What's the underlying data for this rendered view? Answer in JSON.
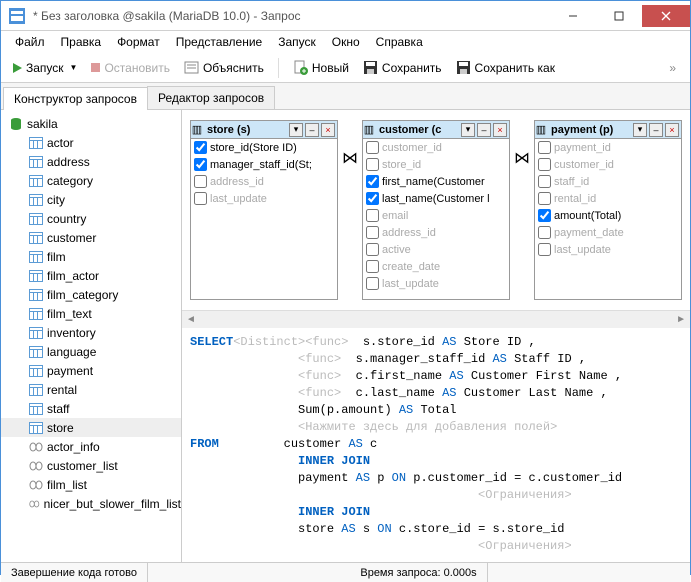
{
  "window": {
    "title": "* Без заголовка @sakila (MariaDB 10.0) - Запрос"
  },
  "menu": [
    "Файл",
    "Правка",
    "Формат",
    "Представление",
    "Запуск",
    "Окно",
    "Справка"
  ],
  "toolbar": {
    "run": "Запуск",
    "stop": "Остановить",
    "explain": "Объяснить",
    "new": "Новый",
    "save": "Сохранить",
    "saveas": "Сохранить как"
  },
  "tabs": {
    "builder": "Конструктор запросов",
    "editor": "Редактор запросов"
  },
  "db": {
    "name": "sakila",
    "tables": [
      "actor",
      "address",
      "category",
      "city",
      "country",
      "customer",
      "film",
      "film_actor",
      "film_category",
      "film_text",
      "inventory",
      "language",
      "payment",
      "rental",
      "staff",
      "store"
    ],
    "views": [
      "actor_info",
      "customer_list",
      "film_list",
      "nicer_but_slower_film_list"
    ]
  },
  "boxes": [
    {
      "title": "store (s)",
      "cols": [
        {
          "c": true,
          "t": "store_id(Store ID)"
        },
        {
          "c": true,
          "t": "manager_staff_id(St;"
        },
        {
          "c": false,
          "t": "address_id",
          "dim": true
        },
        {
          "c": false,
          "t": "last_update",
          "dim": true
        }
      ]
    },
    {
      "title": "customer (c",
      "cols": [
        {
          "c": false,
          "t": "customer_id",
          "dim": true
        },
        {
          "c": false,
          "t": "store_id",
          "dim": true
        },
        {
          "c": true,
          "t": "first_name(Customer"
        },
        {
          "c": true,
          "t": "last_name(Customer l"
        },
        {
          "c": false,
          "t": "email",
          "dim": true
        },
        {
          "c": false,
          "t": "address_id",
          "dim": true
        },
        {
          "c": false,
          "t": "active",
          "dim": true
        },
        {
          "c": false,
          "t": "create_date",
          "dim": true
        },
        {
          "c": false,
          "t": "last_update",
          "dim": true
        }
      ]
    },
    {
      "title": "payment (p)",
      "cols": [
        {
          "c": false,
          "t": "payment_id",
          "dim": true
        },
        {
          "c": false,
          "t": "customer_id",
          "dim": true
        },
        {
          "c": false,
          "t": "staff_id",
          "dim": true
        },
        {
          "c": false,
          "t": "rental_id",
          "dim": true
        },
        {
          "c": true,
          "t": "amount(Total)"
        },
        {
          "c": false,
          "t": "payment_date",
          "dim": true
        },
        {
          "c": false,
          "t": "last_update",
          "dim": true
        }
      ]
    }
  ],
  "sql": {
    "select": "SELECT",
    "from": "FROM",
    "innerjoin": "INNER JOIN",
    "as": "AS",
    "on": "ON",
    "distinct": "<Distinct>",
    "func": "<func>",
    "l1": "s.store_id",
    "a1": "Store ID",
    "l2": "s.manager_staff_id",
    "a2": "Staff ID",
    "l3": "c.first_name",
    "a3": "Customer First Name",
    "l4": "c.last_name",
    "a4": "Customer Last Name",
    "l5": "Sum(p.amount)",
    "a5": "Total",
    "addfields": "<Нажмите здесь для добавления полей>",
    "f1": "customer",
    "fa1": "c",
    "f2": "payment",
    "fa2": "p",
    "on2": "p.customer_id = c.customer_id",
    "f3": "store",
    "fa3": "s",
    "on3": "c.store_id = s.store_id",
    "constraint": "<Ограничения>"
  },
  "status": {
    "left": "Завершение кода готово",
    "right": "Время запроса: 0.000s"
  }
}
